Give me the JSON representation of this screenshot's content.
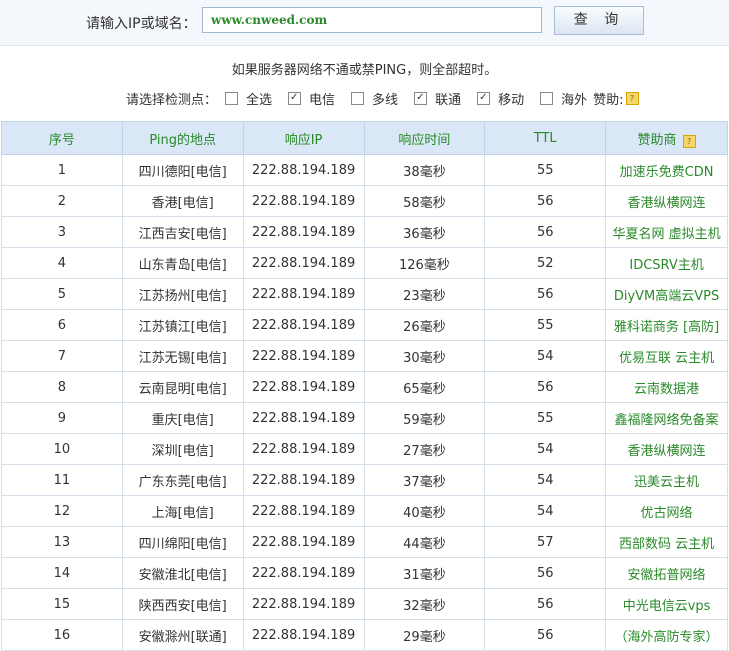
{
  "header": {
    "label": "请输入IP或域名：",
    "input_value": "www.cnweed.com",
    "query_button": "查 询"
  },
  "notice": "如果服务器网络不通或禁PING，则全部超时。",
  "options": {
    "label": "请选择检测点：",
    "items": [
      {
        "label": "全选",
        "checked": false
      },
      {
        "label": "电信",
        "checked": true
      },
      {
        "label": "多线",
        "checked": false
      },
      {
        "label": "联通",
        "checked": true
      },
      {
        "label": "移动",
        "checked": true
      },
      {
        "label": "海外",
        "checked": false
      }
    ],
    "sponsor_label": "赞助:"
  },
  "table": {
    "headers": [
      "序号",
      "Ping的地点",
      "响应IP",
      "响应时间",
      "TTL",
      "赞助商"
    ],
    "rows": [
      [
        "1",
        "四川德阳[电信]",
        "222.88.194.189",
        "38毫秒",
        "55",
        "加速乐免费CDN"
      ],
      [
        "2",
        "香港[电信]",
        "222.88.194.189",
        "58毫秒",
        "56",
        "香港纵横网连"
      ],
      [
        "3",
        "江西吉安[电信]",
        "222.88.194.189",
        "36毫秒",
        "56",
        "华夏名网 虚拟主机"
      ],
      [
        "4",
        "山东青岛[电信]",
        "222.88.194.189",
        "126毫秒",
        "52",
        "IDCSRV主机"
      ],
      [
        "5",
        "江苏扬州[电信]",
        "222.88.194.189",
        "23毫秒",
        "56",
        "DiyVM高端云VPS"
      ],
      [
        "6",
        "江苏镇江[电信]",
        "222.88.194.189",
        "26毫秒",
        "55",
        "雅科诺商务 [高防]"
      ],
      [
        "7",
        "江苏无锡[电信]",
        "222.88.194.189",
        "30毫秒",
        "54",
        "优易互联 云主机"
      ],
      [
        "8",
        "云南昆明[电信]",
        "222.88.194.189",
        "65毫秒",
        "56",
        "云南数据港"
      ],
      [
        "9",
        "重庆[电信]",
        "222.88.194.189",
        "59毫秒",
        "55",
        "鑫福隆网络免备案"
      ],
      [
        "10",
        "深圳[电信]",
        "222.88.194.189",
        "27毫秒",
        "54",
        "香港纵横网连"
      ],
      [
        "11",
        "广东东莞[电信]",
        "222.88.194.189",
        "37毫秒",
        "54",
        "迅美云主机"
      ],
      [
        "12",
        "上海[电信]",
        "222.88.194.189",
        "40毫秒",
        "54",
        "优古网络"
      ],
      [
        "13",
        "四川绵阳[电信]",
        "222.88.194.189",
        "44毫秒",
        "57",
        "西部数码 云主机"
      ],
      [
        "14",
        "安徽淮北[电信]",
        "222.88.194.189",
        "31毫秒",
        "56",
        "安徽拓普网络"
      ],
      [
        "15",
        "陕西西安[电信]",
        "222.88.194.189",
        "32毫秒",
        "56",
        "中光电信云vps"
      ],
      [
        "16",
        "安徽滁州[联通]",
        "222.88.194.189",
        "29毫秒",
        "56",
        "（海外高防专家）"
      ]
    ]
  }
}
